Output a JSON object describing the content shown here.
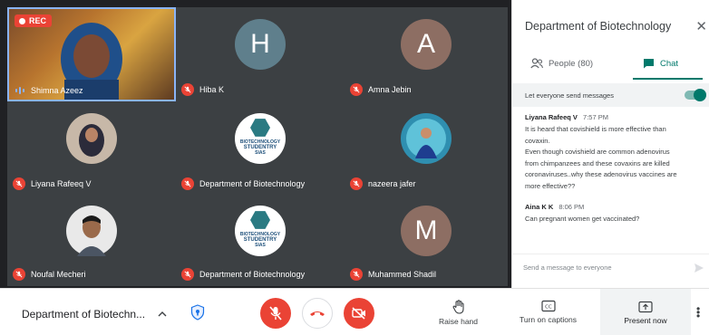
{
  "recording": {
    "label": "REC"
  },
  "tiles": [
    {
      "name": "Shimna Azeez",
      "avatar": "photo",
      "speaking": true
    },
    {
      "name": "Hiba K",
      "initial": "H",
      "color": "#5f7f8c"
    },
    {
      "name": "Amna Jebin",
      "initial": "A",
      "color": "#8d6e63"
    },
    {
      "name": "Liyana Rafeeq V",
      "avatar": "photo"
    },
    {
      "name": "Department of Biotechnology",
      "avatar": "logo",
      "logo_text": [
        "BIOTECHNOLOGY",
        "STUDENTRY",
        "SIAS"
      ]
    },
    {
      "name": "nazeera jafer",
      "avatar": "photo"
    },
    {
      "name": "Noufal Mecheri",
      "avatar": "photo"
    },
    {
      "name": "Department of Biotechnology",
      "avatar": "logo",
      "logo_text": [
        "BIOTECHNOLOGY",
        "STUDENTRY",
        "SIAS"
      ]
    },
    {
      "name": "Muhammed Shadil",
      "initial": "M",
      "color": "#8d6e63"
    }
  ],
  "panel": {
    "title": "Department of Biotechnology",
    "close_icon": "close-icon",
    "tabs": [
      {
        "label": "People (80)",
        "icon": "people-icon",
        "active": false
      },
      {
        "label": "Chat",
        "icon": "chat-icon",
        "active": true
      }
    ],
    "setting_label": "Let everyone send messages",
    "setting_enabled": true,
    "messages": [
      {
        "sender": "Liyana Rafeeq V",
        "time": "7:57 PM",
        "lines": [
          "It is heard that covishield is more effective than",
          "covaxin.",
          "Even though covishield are common adenovirus",
          "from chimpanzees and these covaxins are killed",
          "coronaviruses..why these adenovirus vaccines are",
          "more effective??"
        ]
      },
      {
        "sender": "Aina K K",
        "time": "8:06 PM",
        "lines": [
          "Can pregnant women get vaccinated?"
        ]
      }
    ],
    "compose_placeholder": "Send a message to everyone"
  },
  "bottom_bar": {
    "meeting_name": "Department of Biotechn...",
    "raise_hand": "Raise hand",
    "captions": "Turn on captions",
    "present": "Present now"
  },
  "colors": {
    "accent": "#00796b",
    "danger": "#ea4335",
    "tile_bg": "#3c4043",
    "grid_bg": "#202124"
  }
}
